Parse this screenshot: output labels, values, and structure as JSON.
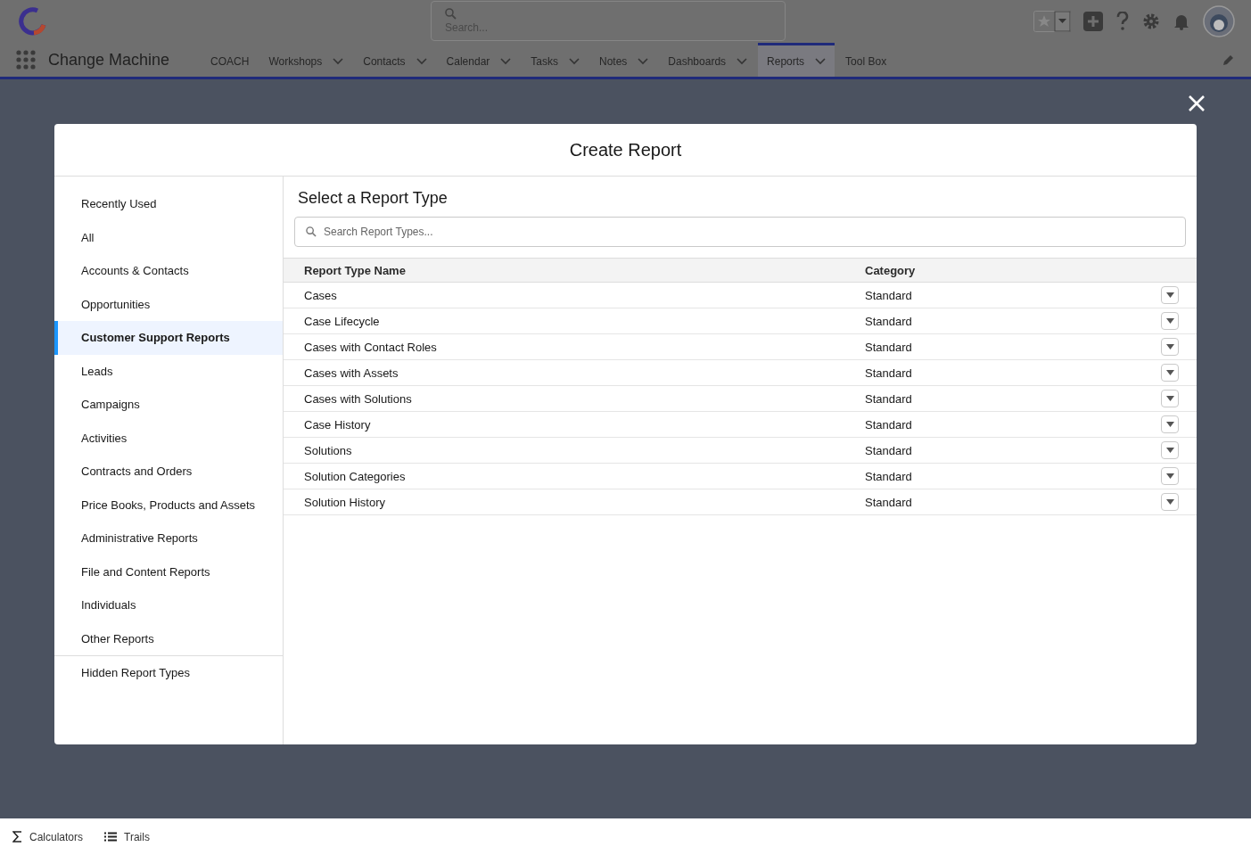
{
  "header": {
    "app_name": "Change Machine",
    "search": {
      "placeholder": "Search..."
    },
    "nav": [
      {
        "label": "COACH",
        "has_menu": false,
        "selected": false
      },
      {
        "label": "Workshops",
        "has_menu": true,
        "selected": false
      },
      {
        "label": "Contacts",
        "has_menu": true,
        "selected": false
      },
      {
        "label": "Calendar",
        "has_menu": true,
        "selected": false
      },
      {
        "label": "Tasks",
        "has_menu": true,
        "selected": false
      },
      {
        "label": "Notes",
        "has_menu": true,
        "selected": false
      },
      {
        "label": "Dashboards",
        "has_menu": true,
        "selected": false
      },
      {
        "label": "Reports",
        "has_menu": true,
        "selected": true
      },
      {
        "label": "Tool Box",
        "has_menu": false,
        "selected": false
      }
    ]
  },
  "modal": {
    "title": "Create Report",
    "heading": "Select a Report Type",
    "search": {
      "placeholder": "Search Report Types..."
    },
    "categories": [
      {
        "label": "Recently Used",
        "selected": false
      },
      {
        "label": "All",
        "selected": false
      },
      {
        "label": "Accounts & Contacts",
        "selected": false
      },
      {
        "label": "Opportunities",
        "selected": false
      },
      {
        "label": "Customer Support Reports",
        "selected": true
      },
      {
        "label": "Leads",
        "selected": false
      },
      {
        "label": "Campaigns",
        "selected": false
      },
      {
        "label": "Activities",
        "selected": false
      },
      {
        "label": "Contracts and Orders",
        "selected": false
      },
      {
        "label": "Price Books, Products and Assets",
        "selected": false
      },
      {
        "label": "Administrative Reports",
        "selected": false
      },
      {
        "label": "File and Content Reports",
        "selected": false
      },
      {
        "label": "Individuals",
        "selected": false
      },
      {
        "label": "Other Reports",
        "selected": false
      }
    ],
    "hidden_category": {
      "label": "Hidden Report Types",
      "selected": false
    },
    "table": {
      "columns": [
        "Report Type Name",
        "Category"
      ],
      "rows": [
        {
          "name": "Cases",
          "category": "Standard"
        },
        {
          "name": "Case Lifecycle",
          "category": "Standard"
        },
        {
          "name": "Cases with Contact Roles",
          "category": "Standard"
        },
        {
          "name": "Cases with Assets",
          "category": "Standard"
        },
        {
          "name": "Cases with Solutions",
          "category": "Standard"
        },
        {
          "name": "Case History",
          "category": "Standard"
        },
        {
          "name": "Solutions",
          "category": "Standard"
        },
        {
          "name": "Solution Categories",
          "category": "Standard"
        },
        {
          "name": "Solution History",
          "category": "Standard"
        }
      ]
    }
  },
  "footer": [
    {
      "label": "Calculators",
      "kind": "sigma"
    },
    {
      "label": "Trails",
      "kind": "list"
    }
  ]
}
